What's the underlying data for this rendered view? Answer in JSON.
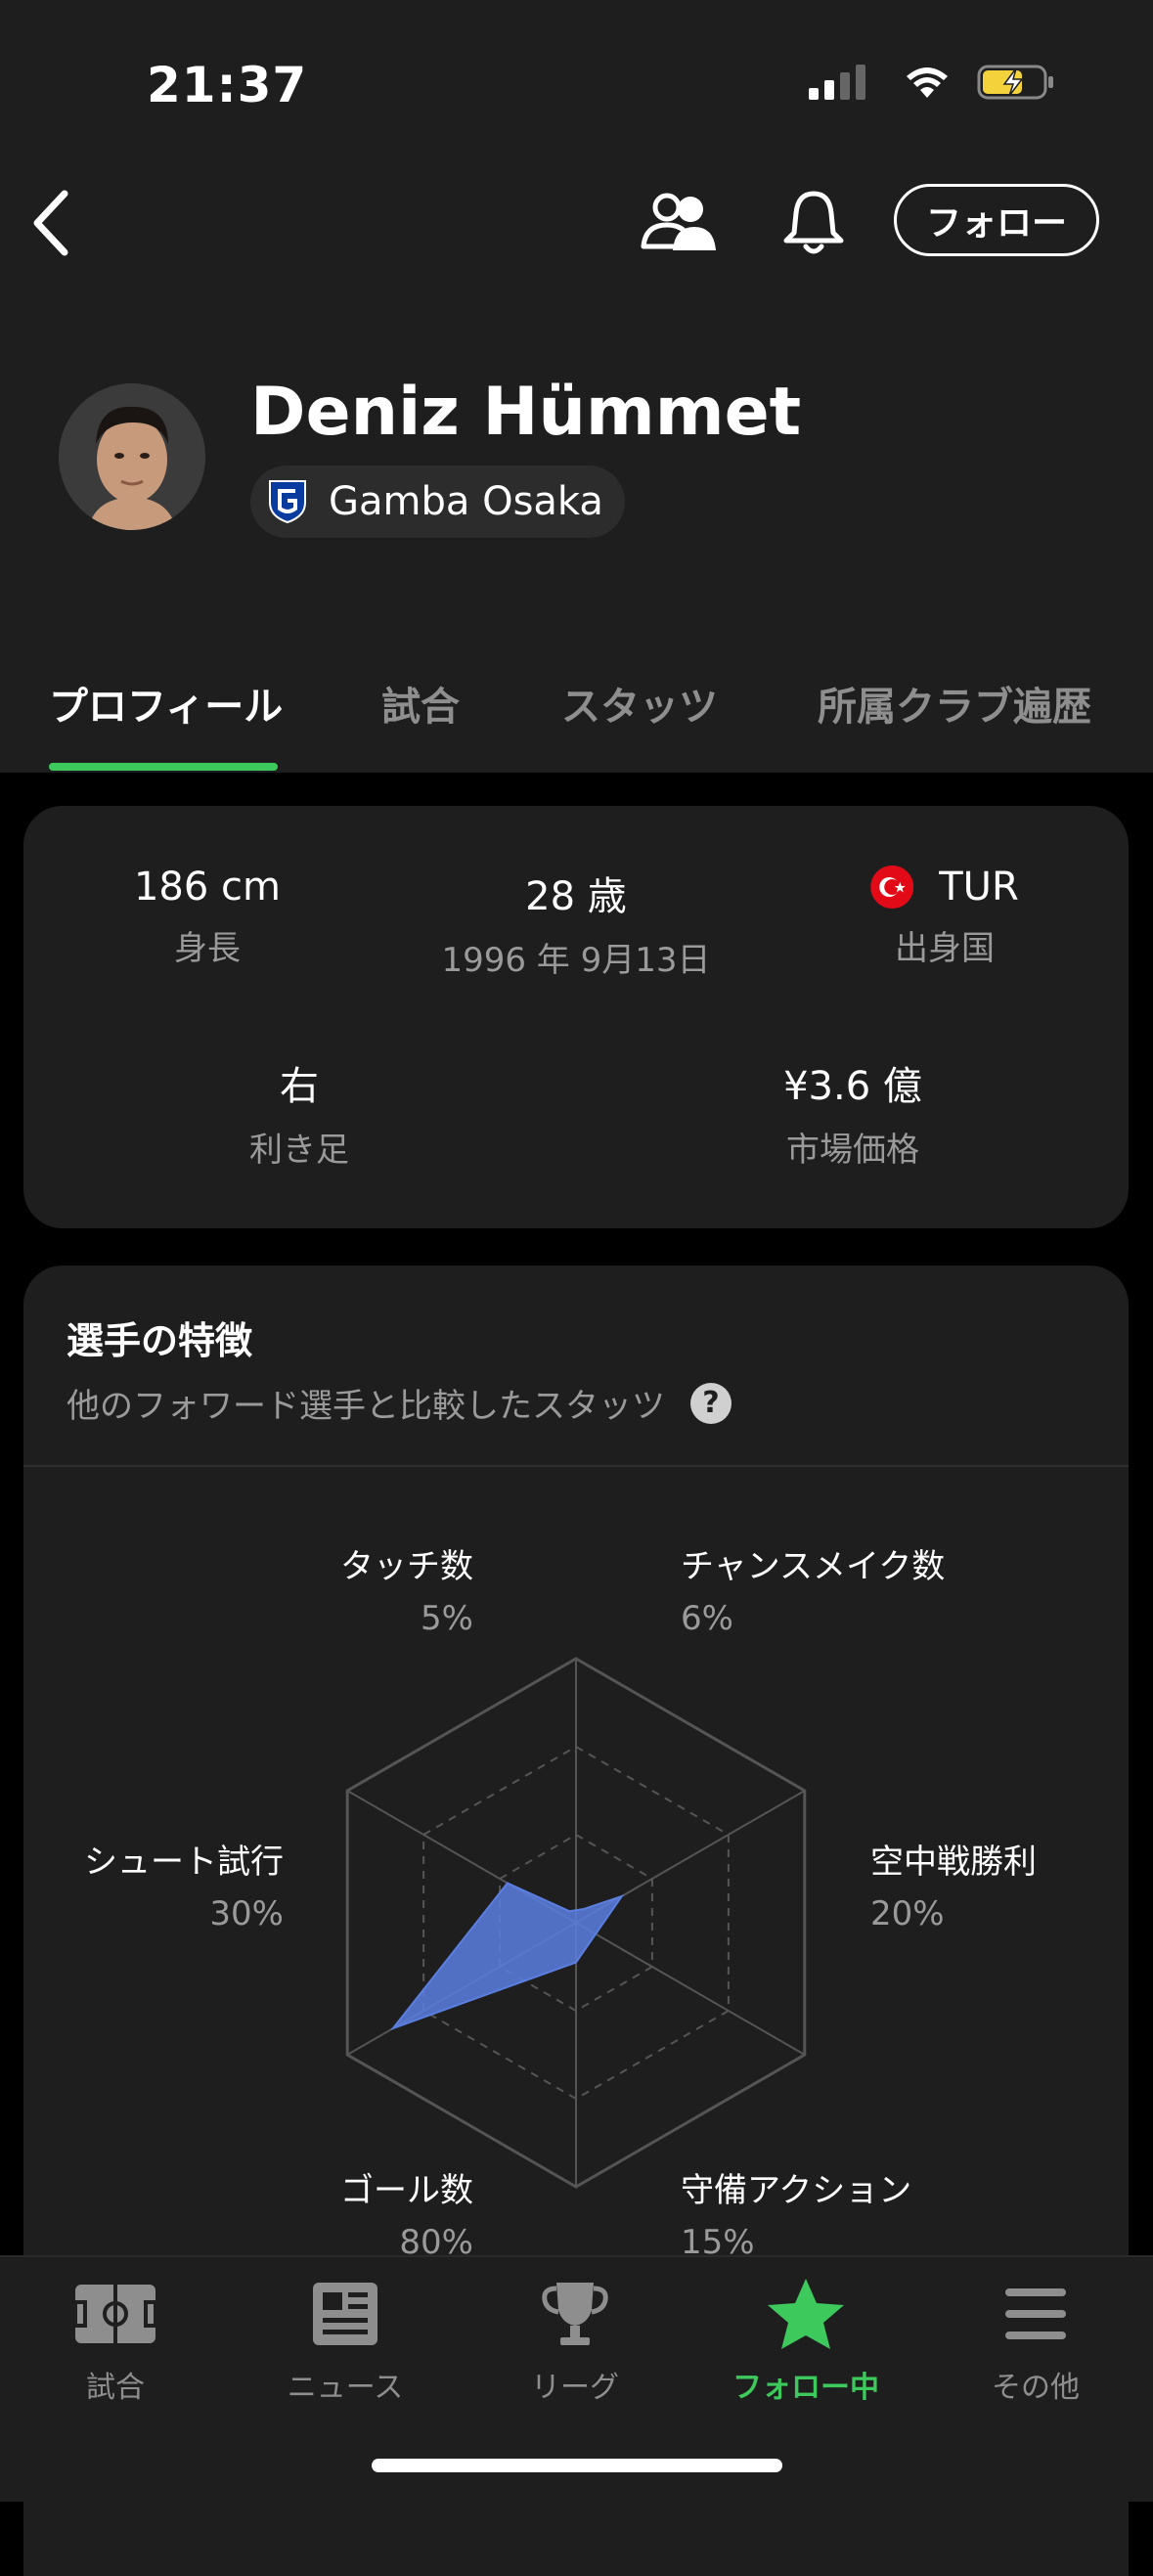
{
  "status": {
    "time": "21:37"
  },
  "header": {
    "follow_label": "フォロー"
  },
  "player": {
    "name": "Deniz Hümmet",
    "club": "Gamba Osaka"
  },
  "tabs": [
    "プロフィール",
    "試合",
    "スタッツ",
    "所属クラブ遍歴"
  ],
  "info": {
    "height": {
      "value": "186 cm",
      "label": "身長"
    },
    "age": {
      "value": "28 歳",
      "label": "1996 年 9月13日"
    },
    "country": {
      "value": "TUR",
      "label": "出身国"
    },
    "foot": {
      "value": "右",
      "label": "利き足"
    },
    "market": {
      "value": "¥3.6 億",
      "label": "市場価格"
    }
  },
  "traits": {
    "title": "選手の特徴",
    "subtitle": "他のフォワード選手と比較したスタッツ",
    "help_icon": "?",
    "attributes": [
      {
        "name": "タッチ数",
        "value": 5,
        "value_text": "5%"
      },
      {
        "name": "チャンスメイク数",
        "value": 6,
        "value_text": "6%"
      },
      {
        "name": "空中戦勝利",
        "value": 20,
        "value_text": "20%"
      },
      {
        "name": "守備アクション",
        "value": 15,
        "value_text": "15%"
      },
      {
        "name": "ゴール数",
        "value": 80,
        "value_text": "80%"
      },
      {
        "name": "シュート試行",
        "value": 30,
        "value_text": "30%"
      }
    ],
    "fill_color": "#5b7fe0"
  },
  "nav": [
    {
      "label": "試合",
      "icon": "pitch-icon"
    },
    {
      "label": "ニュース",
      "icon": "news-icon"
    },
    {
      "label": "リーグ",
      "icon": "trophy-icon"
    },
    {
      "label": "フォロー中",
      "icon": "star-icon"
    },
    {
      "label": "その他",
      "icon": "menu-icon"
    }
  ],
  "accent_color": "#3ec95c"
}
